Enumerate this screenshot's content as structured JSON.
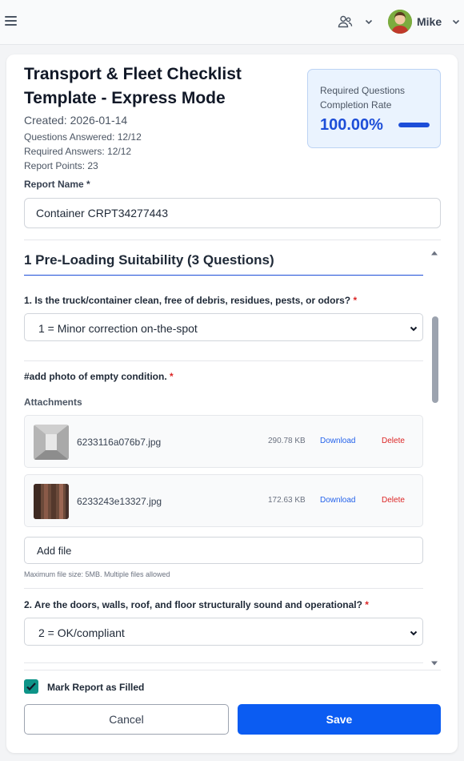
{
  "header": {
    "menu_icon": "hamburger-menu-icon",
    "team_icon": "users-icon",
    "user_name": "Mike"
  },
  "report": {
    "title": "Transport & Fleet Checklist Template - Express Mode",
    "created": "Created: 2026-01-14",
    "questions_answered": "Questions Answered: 12/12",
    "required_answers": "Required Answers: 12/12",
    "report_points": "Report Points: 23",
    "completion_label": "Required Questions Completion Rate",
    "completion_value": "100.00%",
    "completion_fraction": 1.0,
    "report_name_label": "Report Name",
    "report_name_required": "*",
    "report_name_value": "Container CRPT34277443"
  },
  "section": {
    "title": "1 Pre-Loading Suitability (3 Questions)",
    "questions": [
      {
        "label": "1. Is the truck/container clean, free of debris, residues, pests, or odors?",
        "required": "*",
        "selected": "1 = Minor correction on-the-spot"
      },
      {
        "label": "#add photo of empty condition.",
        "required": "*"
      },
      {
        "label": "2. Are the doors, walls, roof, and floor structurally sound and operational?",
        "required": "*",
        "selected": "2 = OK/compliant"
      }
    ],
    "attachments_label": "Attachments",
    "attachments": [
      {
        "name": "6233116a076b7.jpg",
        "size": "290.78 KB",
        "download": "Download",
        "delete": "Delete"
      },
      {
        "name": "6233243e13327.jpg",
        "size": "172.63 KB",
        "download": "Download",
        "delete": "Delete"
      }
    ],
    "add_file_label": "Add file",
    "file_hint": "Maximum file size: 5MB. Multiple files allowed"
  },
  "footer": {
    "mark_filled_label": "Mark Report as Filled",
    "mark_filled_checked": true,
    "cancel_label": "Cancel",
    "save_label": "Save"
  },
  "colors": {
    "accent": "#0b5cf2",
    "rate_blue": "#1d4ed8",
    "required_red": "#dc2626",
    "checkbox_teal": "#0d9488"
  }
}
